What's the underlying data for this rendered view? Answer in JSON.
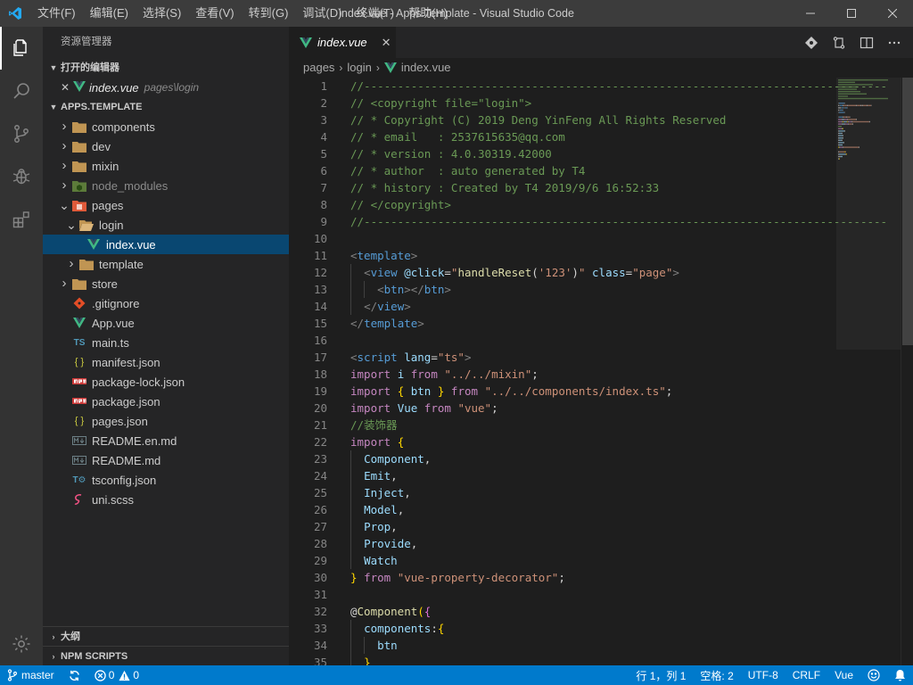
{
  "titlebar": {
    "menu": [
      "文件(F)",
      "编辑(E)",
      "选择(S)",
      "查看(V)",
      "转到(G)",
      "调试(D)",
      "终端(T)",
      "帮助(H)"
    ],
    "title": "index.vue - Apps.Template - Visual Studio Code"
  },
  "sidebar": {
    "title": "资源管理器",
    "open_editors": {
      "header": "打开的编辑器",
      "items": [
        {
          "name": "index.vue",
          "path": "pages\\login"
        }
      ]
    },
    "workspace": {
      "header": "APPS.TEMPLATE",
      "tree": [
        {
          "label": "components",
          "kind": "folder",
          "depth": 0,
          "expanded": false
        },
        {
          "label": "dev",
          "kind": "folder",
          "depth": 0,
          "expanded": false
        },
        {
          "label": "mixin",
          "kind": "folder",
          "depth": 0,
          "expanded": false
        },
        {
          "label": "node_modules",
          "kind": "folder-node",
          "depth": 0,
          "expanded": false,
          "dim": true
        },
        {
          "label": "pages",
          "kind": "folder-pages",
          "depth": 0,
          "expanded": true
        },
        {
          "label": "login",
          "kind": "folder-open",
          "depth": 1,
          "expanded": true
        },
        {
          "label": "index.vue",
          "kind": "vue",
          "depth": 2,
          "selected": true
        },
        {
          "label": "template",
          "kind": "folder",
          "depth": 1,
          "expanded": false
        },
        {
          "label": "store",
          "kind": "folder",
          "depth": 0,
          "expanded": false
        },
        {
          "label": ".gitignore",
          "kind": "git",
          "depth": 0
        },
        {
          "label": "App.vue",
          "kind": "vue",
          "depth": 0
        },
        {
          "label": "main.ts",
          "kind": "ts",
          "depth": 0
        },
        {
          "label": "manifest.json",
          "kind": "json",
          "depth": 0
        },
        {
          "label": "package-lock.json",
          "kind": "npm",
          "depth": 0
        },
        {
          "label": "package.json",
          "kind": "npm",
          "depth": 0
        },
        {
          "label": "pages.json",
          "kind": "json",
          "depth": 0
        },
        {
          "label": "README.en.md",
          "kind": "md",
          "depth": 0
        },
        {
          "label": "README.md",
          "kind": "md",
          "depth": 0
        },
        {
          "label": "tsconfig.json",
          "kind": "tsconfig",
          "depth": 0
        },
        {
          "label": "uni.scss",
          "kind": "scss",
          "depth": 0
        }
      ]
    },
    "bottom_sections": [
      "大纲",
      "NPM SCRIPTS"
    ]
  },
  "editor": {
    "tab": {
      "label": "index.vue"
    },
    "breadcrumbs": [
      "pages",
      "login",
      "index.vue"
    ],
    "lines": [
      {
        "n": "1",
        "g": 0,
        "t": [
          [
            "c-com",
            "//------------------------------------------------------------------------------"
          ]
        ]
      },
      {
        "n": "2",
        "g": 0,
        "t": [
          [
            "c-com",
            "// <copyright file=\"login\">"
          ]
        ]
      },
      {
        "n": "3",
        "g": 0,
        "t": [
          [
            "c-com",
            "// * Copyright (C) 2019 Deng YinFeng All Rights Reserved"
          ]
        ]
      },
      {
        "n": "4",
        "g": 0,
        "t": [
          [
            "c-com",
            "// * email   : 2537615635@qq.com"
          ]
        ]
      },
      {
        "n": "5",
        "g": 0,
        "t": [
          [
            "c-com",
            "// * version : 4.0.30319.42000"
          ]
        ]
      },
      {
        "n": "6",
        "g": 0,
        "t": [
          [
            "c-com",
            "// * author  : auto generated by T4"
          ]
        ]
      },
      {
        "n": "7",
        "g": 0,
        "t": [
          [
            "c-com",
            "// * history : Created by T4 2019/9/6 16:52:33"
          ]
        ]
      },
      {
        "n": "8",
        "g": 0,
        "t": [
          [
            "c-com",
            "// </copyright>"
          ]
        ]
      },
      {
        "n": "9",
        "g": 0,
        "t": [
          [
            "c-com",
            "//------------------------------------------------------------------------------"
          ]
        ]
      },
      {
        "n": "10",
        "g": 0,
        "t": []
      },
      {
        "n": "11",
        "g": 0,
        "t": [
          [
            "c-punc",
            "<"
          ],
          [
            "c-tag",
            "template"
          ],
          [
            "c-punc",
            ">"
          ]
        ]
      },
      {
        "n": "12",
        "g": 1,
        "t": [
          [
            "c-def",
            "  "
          ],
          [
            "c-punc",
            "<"
          ],
          [
            "c-tag",
            "view"
          ],
          [
            "c-def",
            " "
          ],
          [
            "c-attr",
            "@click"
          ],
          [
            "c-def",
            "="
          ],
          [
            "c-str",
            "\""
          ],
          [
            "c-fn",
            "handleReset"
          ],
          [
            "c-def",
            "("
          ],
          [
            "c-str",
            "'123'"
          ],
          [
            "c-def",
            ")"
          ],
          [
            "c-str",
            "\""
          ],
          [
            "c-def",
            " "
          ],
          [
            "c-attr",
            "class"
          ],
          [
            "c-def",
            "="
          ],
          [
            "c-str",
            "\"page\""
          ],
          [
            "c-punc",
            ">"
          ]
        ]
      },
      {
        "n": "13",
        "g": 2,
        "t": [
          [
            "c-def",
            "    "
          ],
          [
            "c-punc",
            "<"
          ],
          [
            "c-tag",
            "btn"
          ],
          [
            "c-punc",
            "></"
          ],
          [
            "c-tag",
            "btn"
          ],
          [
            "c-punc",
            ">"
          ]
        ]
      },
      {
        "n": "14",
        "g": 1,
        "t": [
          [
            "c-def",
            "  "
          ],
          [
            "c-punc",
            "</"
          ],
          [
            "c-tag",
            "view"
          ],
          [
            "c-punc",
            ">"
          ]
        ]
      },
      {
        "n": "15",
        "g": 0,
        "t": [
          [
            "c-punc",
            "</"
          ],
          [
            "c-tag",
            "template"
          ],
          [
            "c-punc",
            ">"
          ]
        ]
      },
      {
        "n": "16",
        "g": 0,
        "t": []
      },
      {
        "n": "17",
        "g": 0,
        "t": [
          [
            "c-punc",
            "<"
          ],
          [
            "c-tag",
            "script"
          ],
          [
            "c-def",
            " "
          ],
          [
            "c-attr",
            "lang"
          ],
          [
            "c-def",
            "="
          ],
          [
            "c-str",
            "\"ts\""
          ],
          [
            "c-punc",
            ">"
          ]
        ]
      },
      {
        "n": "18",
        "g": 0,
        "t": [
          [
            "c-kw",
            "import"
          ],
          [
            "c-def",
            " "
          ],
          [
            "c-var",
            "i"
          ],
          [
            "c-def",
            " "
          ],
          [
            "c-kw",
            "from"
          ],
          [
            "c-def",
            " "
          ],
          [
            "c-str",
            "\"../../mixin\""
          ],
          [
            "c-def",
            ";"
          ]
        ]
      },
      {
        "n": "19",
        "g": 0,
        "t": [
          [
            "c-kw",
            "import"
          ],
          [
            "c-def",
            " "
          ],
          [
            "c-br",
            "{"
          ],
          [
            "c-def",
            " "
          ],
          [
            "c-var",
            "btn"
          ],
          [
            "c-def",
            " "
          ],
          [
            "c-br",
            "}"
          ],
          [
            "c-def",
            " "
          ],
          [
            "c-kw",
            "from"
          ],
          [
            "c-def",
            " "
          ],
          [
            "c-str",
            "\"../../components/index.ts\""
          ],
          [
            "c-def",
            ";"
          ]
        ]
      },
      {
        "n": "20",
        "g": 0,
        "t": [
          [
            "c-kw",
            "import"
          ],
          [
            "c-def",
            " "
          ],
          [
            "c-var",
            "Vue"
          ],
          [
            "c-def",
            " "
          ],
          [
            "c-kw",
            "from"
          ],
          [
            "c-def",
            " "
          ],
          [
            "c-str",
            "\"vue\""
          ],
          [
            "c-def",
            ";"
          ]
        ]
      },
      {
        "n": "21",
        "g": 0,
        "t": [
          [
            "c-com",
            "//装饰器"
          ]
        ]
      },
      {
        "n": "22",
        "g": 0,
        "t": [
          [
            "c-kw",
            "import"
          ],
          [
            "c-def",
            " "
          ],
          [
            "c-br",
            "{"
          ]
        ]
      },
      {
        "n": "23",
        "g": 1,
        "t": [
          [
            "c-def",
            "  "
          ],
          [
            "c-var",
            "Component"
          ],
          [
            "c-def",
            ","
          ]
        ]
      },
      {
        "n": "24",
        "g": 1,
        "t": [
          [
            "c-def",
            "  "
          ],
          [
            "c-var",
            "Emit"
          ],
          [
            "c-def",
            ","
          ]
        ]
      },
      {
        "n": "25",
        "g": 1,
        "t": [
          [
            "c-def",
            "  "
          ],
          [
            "c-var",
            "Inject"
          ],
          [
            "c-def",
            ","
          ]
        ]
      },
      {
        "n": "26",
        "g": 1,
        "t": [
          [
            "c-def",
            "  "
          ],
          [
            "c-var",
            "Model"
          ],
          [
            "c-def",
            ","
          ]
        ]
      },
      {
        "n": "27",
        "g": 1,
        "t": [
          [
            "c-def",
            "  "
          ],
          [
            "c-var",
            "Prop"
          ],
          [
            "c-def",
            ","
          ]
        ]
      },
      {
        "n": "28",
        "g": 1,
        "t": [
          [
            "c-def",
            "  "
          ],
          [
            "c-var",
            "Provide"
          ],
          [
            "c-def",
            ","
          ]
        ]
      },
      {
        "n": "29",
        "g": 1,
        "t": [
          [
            "c-def",
            "  "
          ],
          [
            "c-var",
            "Watch"
          ]
        ]
      },
      {
        "n": "30",
        "g": 0,
        "t": [
          [
            "c-br",
            "}"
          ],
          [
            "c-def",
            " "
          ],
          [
            "c-kw",
            "from"
          ],
          [
            "c-def",
            " "
          ],
          [
            "c-str",
            "\"vue-property-decorator\""
          ],
          [
            "c-def",
            ";"
          ]
        ]
      },
      {
        "n": "31",
        "g": 0,
        "t": []
      },
      {
        "n": "32",
        "g": 0,
        "t": [
          [
            "c-def",
            "@"
          ],
          [
            "c-fn",
            "Component"
          ],
          [
            "c-br",
            "("
          ],
          [
            "c-br2",
            "{"
          ]
        ]
      },
      {
        "n": "33",
        "g": 1,
        "t": [
          [
            "c-def",
            "  "
          ],
          [
            "c-var",
            "components"
          ],
          [
            "c-def",
            ":"
          ],
          [
            "c-br",
            "{"
          ]
        ]
      },
      {
        "n": "34",
        "g": 2,
        "t": [
          [
            "c-def",
            "    "
          ],
          [
            "c-var",
            "btn"
          ]
        ]
      },
      {
        "n": "35",
        "g": 1,
        "t": [
          [
            "c-def",
            "  "
          ],
          [
            "c-br",
            "}"
          ]
        ]
      }
    ]
  },
  "statusbar": {
    "branch": "master",
    "errors": "0",
    "warnings": "0",
    "position": "行 1，列 1",
    "spaces": "空格: 2",
    "encoding": "UTF-8",
    "eol": "CRLF",
    "language": "Vue"
  },
  "colors": {
    "accent": "#007acc",
    "selection": "#094771",
    "vue_green": "#41b883",
    "folder": "#c09553"
  }
}
